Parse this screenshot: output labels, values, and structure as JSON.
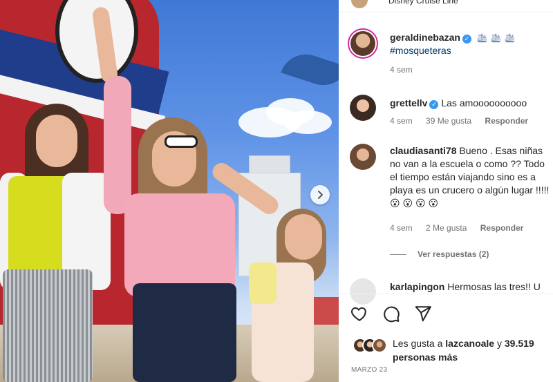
{
  "post_location": "Disney Cruise Line",
  "caption": {
    "username": "geraldinebazan",
    "verified_mark": "✓",
    "emoji": "🛳 🛳 🛳",
    "hashtag": "#mosqueteras",
    "time": "4 sem"
  },
  "comments": [
    {
      "username": "grettellv",
      "verified_mark": "✓",
      "text": "Las amoooooooooo",
      "time": "4 sem",
      "likes": "39 Me gusta",
      "reply_label": "Responder"
    },
    {
      "username": "claudiasanti78",
      "text": "Bueno . Esas niñas no van a la escuela o como ?? Todo el tiempo están viajando sino es a playa es un crucero o algún lugar !!!!!😮 😮 😮 😮",
      "time": "4 sem",
      "likes": "2 Me gusta",
      "reply_label": "Responder"
    },
    {
      "username": "karlapingon",
      "text": "Hermosas las tres!! U"
    }
  ],
  "view_replies": "Ver respuestas (2)",
  "actions": {
    "like_icon": "heart-icon",
    "comment_icon": "comment-icon",
    "share_icon": "share-icon"
  },
  "likes_summary": {
    "prefix": "Les gusta a",
    "username": "lazcanoale",
    "connector": "y",
    "count": "39.519",
    "suffix": "personas más"
  },
  "date": "MARZO 23",
  "colors": {
    "link": "#00376b",
    "verified": "#3897f0",
    "muted": "#737373"
  }
}
